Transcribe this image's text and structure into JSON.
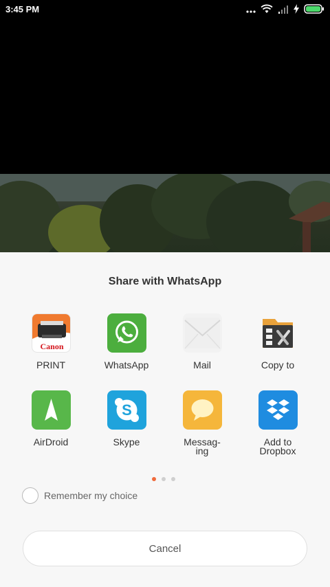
{
  "status_bar": {
    "time": "3:45 PM",
    "icons": [
      "more-dots-icon",
      "wifi-icon",
      "signal-icon",
      "charging-icon",
      "battery-icon"
    ]
  },
  "share_sheet": {
    "title": "Share with WhatsApp",
    "apps": [
      {
        "label": "PRINT",
        "icon": "canon-print-icon",
        "brand_text": "Canon"
      },
      {
        "label": "WhatsApp",
        "icon": "whatsapp-icon"
      },
      {
        "label": "Mail",
        "icon": "mail-icon"
      },
      {
        "label": "Copy to",
        "icon": "file-manager-icon"
      },
      {
        "label": "AirDroid",
        "icon": "airdroid-icon"
      },
      {
        "label": "Skype",
        "icon": "skype-icon"
      },
      {
        "label": "Messag-\ning",
        "icon": "messaging-icon"
      },
      {
        "label": "Add to\nDropbox",
        "icon": "dropbox-icon"
      }
    ],
    "pager": {
      "pages": 3,
      "current": 1
    },
    "remember_label": "Remember my choice",
    "cancel_label": "Cancel"
  },
  "colors": {
    "accent_dot": "#f06a3b",
    "whatsapp": "#4cae3e",
    "airdroid": "#58b74a",
    "skype": "#1fa3dc",
    "messaging": "#f5b63b",
    "dropbox": "#1f8ce0"
  }
}
